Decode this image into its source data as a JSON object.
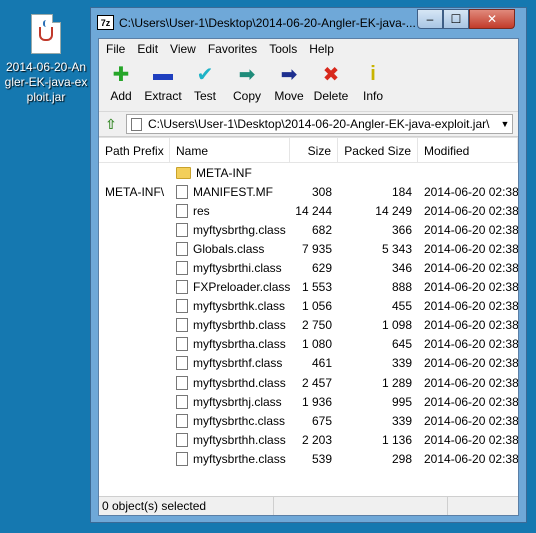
{
  "desktop": {
    "icon_label": "2014-06-20-Angler-EK-java-exploit.jar"
  },
  "window": {
    "app_icon_text": "7z",
    "title": "C:\\Users\\User-1\\Desktop\\2014-06-20-Angler-EK-java-...",
    "minimize": "–",
    "maximize": "☐",
    "close": "✕"
  },
  "menu": [
    "File",
    "Edit",
    "View",
    "Favorites",
    "Tools",
    "Help"
  ],
  "toolbar": [
    {
      "label": "Add",
      "icon": "plus-icon",
      "glyph": "✚",
      "color": "#26a629"
    },
    {
      "label": "Extract",
      "icon": "minus-icon",
      "glyph": "▬",
      "color": "#1f3fbf"
    },
    {
      "label": "Test",
      "icon": "check-icon",
      "glyph": "✔",
      "color": "#1fb3c7"
    },
    {
      "label": "Copy",
      "icon": "copy-arrow-icon",
      "glyph": "➡",
      "color": "#1f8c7a"
    },
    {
      "label": "Move",
      "icon": "move-arrow-icon",
      "glyph": "➡",
      "color": "#1d2f8f"
    },
    {
      "label": "Delete",
      "icon": "delete-x-icon",
      "glyph": "✖",
      "color": "#d8281c"
    },
    {
      "label": "Info",
      "icon": "info-icon",
      "glyph": "i",
      "color": "#c8b400"
    }
  ],
  "address": {
    "path": "C:\\Users\\User-1\\Desktop\\2014-06-20-Angler-EK-java-exploit.jar\\",
    "dropdown": "▼"
  },
  "columns": {
    "prefix": "Path Prefix",
    "name": "Name",
    "size": "Size",
    "packed": "Packed Size",
    "modified": "Modified"
  },
  "rows": [
    {
      "prefix": "",
      "name": "META-INF",
      "size": "",
      "packed": "",
      "modified": "",
      "folder": true
    },
    {
      "prefix": "META-INF\\",
      "name": "MANIFEST.MF",
      "size": "308",
      "packed": "184",
      "modified": "2014-06-20 02:38"
    },
    {
      "prefix": "",
      "name": "res",
      "size": "14 244",
      "packed": "14 249",
      "modified": "2014-06-20 02:38"
    },
    {
      "prefix": "",
      "name": "myftysbrthg.class",
      "size": "682",
      "packed": "366",
      "modified": "2014-06-20 02:38"
    },
    {
      "prefix": "",
      "name": "Globals.class",
      "size": "7 935",
      "packed": "5 343",
      "modified": "2014-06-20 02:38"
    },
    {
      "prefix": "",
      "name": "myftysbrthi.class",
      "size": "629",
      "packed": "346",
      "modified": "2014-06-20 02:38"
    },
    {
      "prefix": "",
      "name": "FXPreloader.class",
      "size": "1 553",
      "packed": "888",
      "modified": "2014-06-20 02:38"
    },
    {
      "prefix": "",
      "name": "myftysbrthk.class",
      "size": "1 056",
      "packed": "455",
      "modified": "2014-06-20 02:38"
    },
    {
      "prefix": "",
      "name": "myftysbrthb.class",
      "size": "2 750",
      "packed": "1 098",
      "modified": "2014-06-20 02:38"
    },
    {
      "prefix": "",
      "name": "myftysbrtha.class",
      "size": "1 080",
      "packed": "645",
      "modified": "2014-06-20 02:38"
    },
    {
      "prefix": "",
      "name": "myftysbrthf.class",
      "size": "461",
      "packed": "339",
      "modified": "2014-06-20 02:38"
    },
    {
      "prefix": "",
      "name": "myftysbrthd.class",
      "size": "2 457",
      "packed": "1 289",
      "modified": "2014-06-20 02:38"
    },
    {
      "prefix": "",
      "name": "myftysbrthj.class",
      "size": "1 936",
      "packed": "995",
      "modified": "2014-06-20 02:38"
    },
    {
      "prefix": "",
      "name": "myftysbrthc.class",
      "size": "675",
      "packed": "339",
      "modified": "2014-06-20 02:38"
    },
    {
      "prefix": "",
      "name": "myftysbrthh.class",
      "size": "2 203",
      "packed": "1 136",
      "modified": "2014-06-20 02:38"
    },
    {
      "prefix": "",
      "name": "myftysbrthe.class",
      "size": "539",
      "packed": "298",
      "modified": "2014-06-20 02:38"
    }
  ],
  "status": {
    "selected": "0 object(s) selected"
  }
}
